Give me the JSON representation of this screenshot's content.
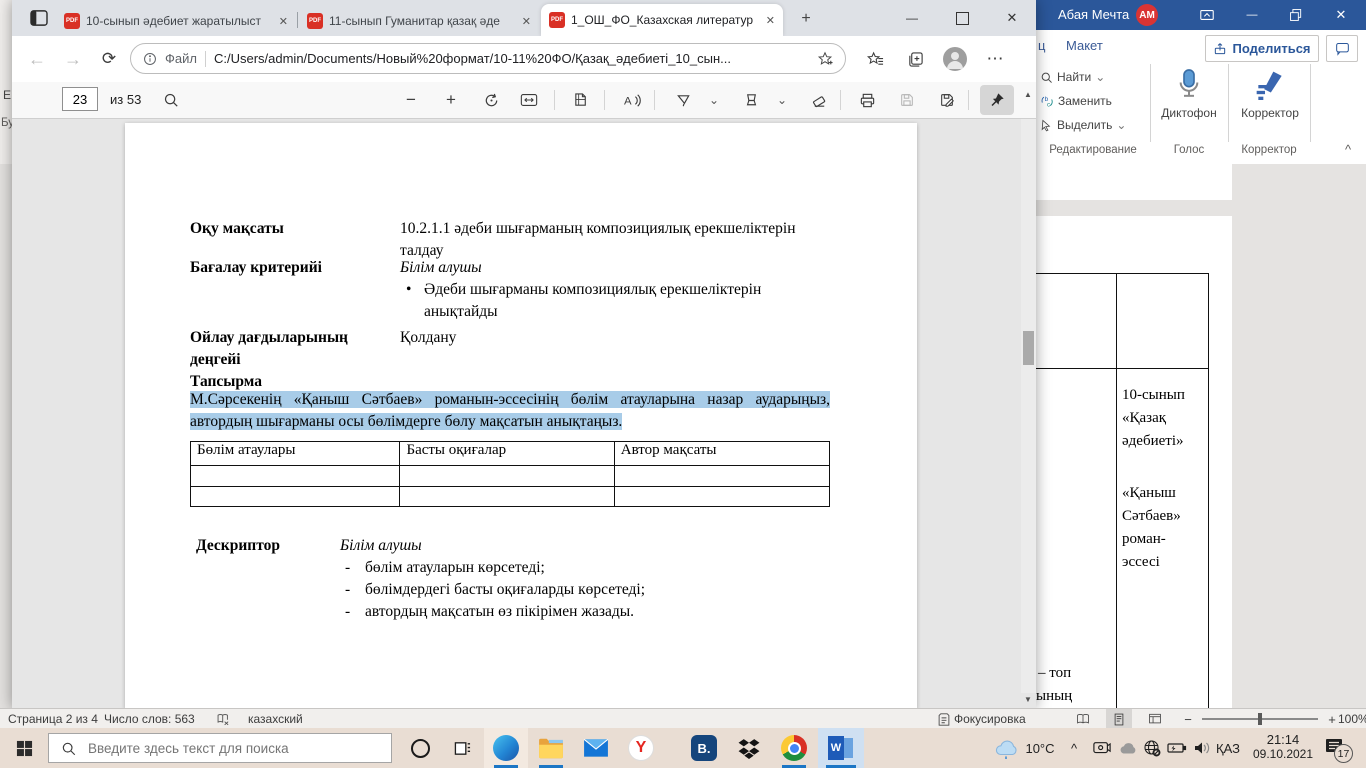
{
  "browser": {
    "tabs": [
      {
        "title": "10-сынып әдебиет жаратылыст"
      },
      {
        "title": "11-сынып Гуманитар қазақ әде"
      },
      {
        "title": "1_ОШ_ФО_Казахская литератур"
      }
    ],
    "pdf_badge": "PDF",
    "address": {
      "scheme_label": "Файл",
      "url": "C:/Users/admin/Documents/Новый%20формат/10-11%20ФО/Қазақ_әдебиеті_10_сын..."
    },
    "pdf_toolbar": {
      "page_value": "23",
      "page_total": "из 53"
    }
  },
  "pdf_doc": {
    "rows": {
      "goal_label": "Оқу мақсаты",
      "goal_value_line1": "10.2.1.1 әдеби шығарманың композициялық ерекшеліктерін",
      "goal_value_line2": "талдау",
      "criteria_label": "Бағалау критерийі",
      "criteria_intro": "Білім алушы",
      "criteria_bullet_line1": "Әдеби шығарманы композициялық ерекшеліктерін",
      "criteria_bullet_line2": "анықтайды",
      "level_label_line1": "Ойлау дағдыларының",
      "level_label_line2": "деңгейі",
      "level_value": "Қолдану",
      "task_label": "Тапсырма"
    },
    "task_line1": "М.Сәрсекенің «Қаныш Сәтбаев» романын-эссесінің бөлім атауларына назар аударыңыз,",
    "task_line2": "автордың шығарманы осы бөлімдерге бөлу мақсатын анықтаңыз.",
    "table_headers": [
      "Бөлім атаулары",
      "Басты оқиғалар",
      "Автор мақсаты"
    ],
    "descriptor": {
      "label": "Дескриптор",
      "intro": "Білім алушы",
      "items": [
        "бөлім атауларын көрсетеді;",
        "бөлімдердегі басты оқиғаларды көрсетеді;",
        "автордың мақсатын өз пікірімен жазады."
      ]
    }
  },
  "word": {
    "title": "Абая Мечта",
    "avatar": "AM",
    "tab_fragment": "ц",
    "tab_layout": "Макет",
    "share_label": "Поделиться",
    "ribbon": {
      "find": "Найти",
      "replace": "Заменить",
      "select": "Выделить",
      "dictaphone": "Диктофон",
      "corrector": "Корректор",
      "group_editing": "Редактирование",
      "group_voice": "Голос",
      "group_corrector": "Корректор"
    },
    "doc": {
      "cell1_lines": [
        "10-сынып",
        "«Қазақ",
        "әдебиеті»"
      ],
      "cell2_lines": [
        "«Қаныш",
        "Сәтбаев»",
        "роман-",
        "эссесі"
      ],
      "fragment_line1": "– топ",
      "fragment_line2": "ының"
    },
    "edge_fragments": {
      "top": "Е",
      "group": "Буф"
    },
    "status": {
      "page": "Страница 2 из 4",
      "words": "Число слов: 563",
      "language": "казахский",
      "focus": "Фокусировка",
      "zoom": "100%"
    }
  },
  "taskbar": {
    "search_placeholder": "Введите здесь текст для поиска",
    "booking_label": "B.",
    "yandex_label": "Y",
    "word_label": "W",
    "tray": {
      "temperature": "10°C",
      "language": "ҚАЗ",
      "time": "21:14",
      "date": "09.10.2021",
      "notification_count": "17"
    }
  },
  "glyphs": {
    "close": "✕",
    "minimize": "—",
    "plus": "+",
    "minus": "−",
    "chevron_down": "⌄",
    "chevron_up": "^",
    "up": "▲",
    "down": "▼",
    "back": "←",
    "forward": "→",
    "refresh": "⟳",
    "dash": "-",
    "bullet": "•",
    "menu": "⋯",
    "pipe": "|"
  }
}
